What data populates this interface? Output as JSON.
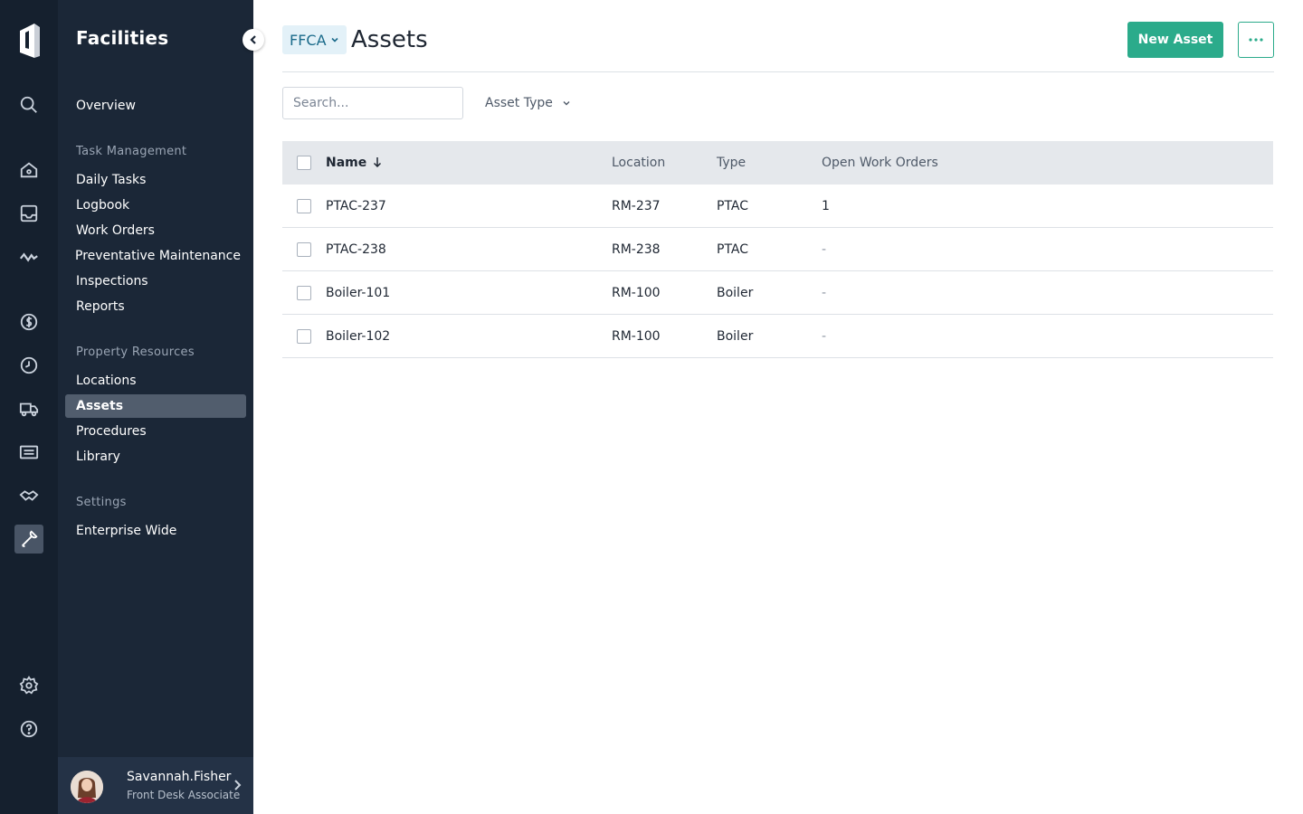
{
  "sidebar": {
    "title": "Facilities",
    "overview": "Overview",
    "sections": [
      {
        "label": "Task Management",
        "items": [
          "Daily Tasks",
          "Logbook",
          "Work Orders",
          "Preventative Maintenance",
          "Inspections",
          "Reports"
        ]
      },
      {
        "label": "Property Resources",
        "items": [
          "Locations",
          "Assets",
          "Procedures",
          "Library"
        ]
      },
      {
        "label": "Settings",
        "items": [
          "Enterprise Wide"
        ]
      }
    ],
    "active_item": "Assets"
  },
  "rail_icons": [
    "logo-icon",
    "search-icon",
    "home-icon",
    "inbox-icon",
    "activity-icon",
    "dollar-icon",
    "clock-icon",
    "truck-icon",
    "keyboard-icon",
    "handshake-icon",
    "wrench-icon",
    "gear-icon",
    "help-icon"
  ],
  "user": {
    "name": "Savannah.Fisher",
    "role": "Front Desk Associate"
  },
  "header": {
    "org": "FFCA",
    "title": "Assets",
    "new_button": "New Asset"
  },
  "filters": {
    "search_placeholder": "Search...",
    "asset_type": "Asset Type"
  },
  "table": {
    "columns": {
      "name": "Name",
      "location": "Location",
      "type": "Type",
      "open_work_orders": "Open Work Orders"
    },
    "rows": [
      {
        "name": "PTAC-237",
        "location": "RM-237",
        "type": "PTAC",
        "open_work_orders": "1"
      },
      {
        "name": "PTAC-238",
        "location": "RM-238",
        "type": "PTAC",
        "open_work_orders": "-"
      },
      {
        "name": "Boiler-101",
        "location": "RM-100",
        "type": "Boiler",
        "open_work_orders": "-"
      },
      {
        "name": "Boiler-102",
        "location": "RM-100",
        "type": "Boiler",
        "open_work_orders": "-"
      }
    ]
  },
  "colors": {
    "accent": "#2bab8b",
    "rail_bg": "#15202e",
    "sidebar_bg": "#1b2737"
  }
}
